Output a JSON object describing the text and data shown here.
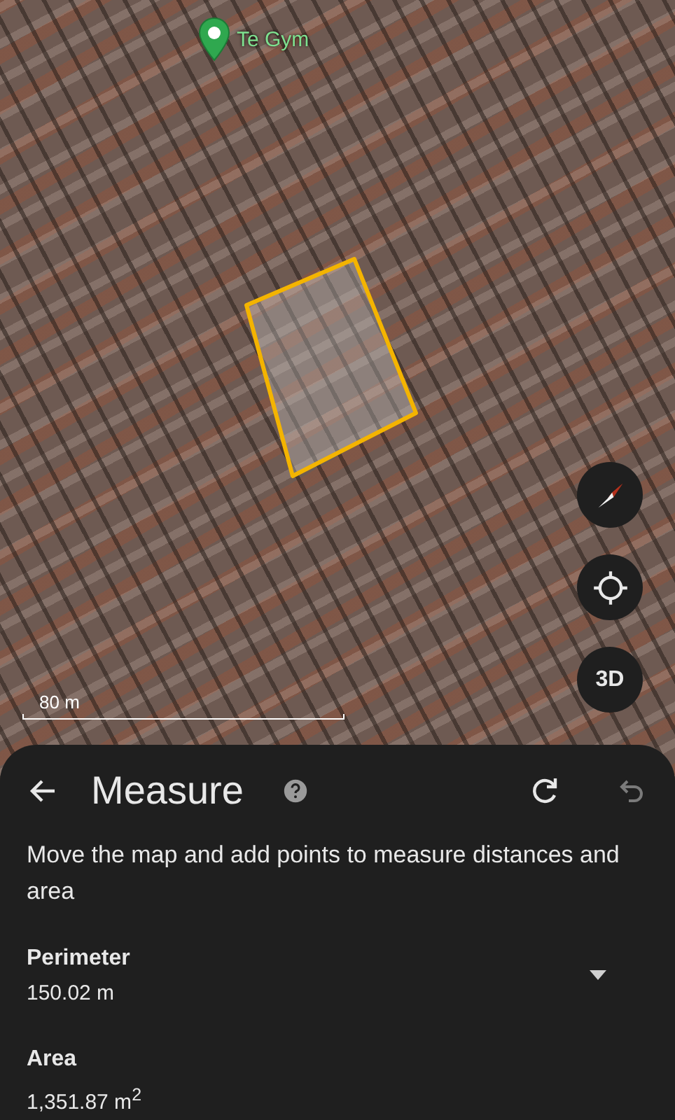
{
  "map": {
    "place_label": "Te Gym",
    "scale": "80 m"
  },
  "map_controls": [
    {
      "kind": "compass"
    },
    {
      "kind": "locate"
    },
    {
      "kind": "tilt",
      "label": "3D"
    }
  ],
  "panel": {
    "title": "Measure",
    "actions": [
      {
        "kind": "clear",
        "disabled": false
      },
      {
        "kind": "undo",
        "disabled": true
      }
    ],
    "instructions": "Move the map and add points to measure distances and area",
    "measurements": [
      {
        "label": "Perimeter",
        "value": "150.02 m",
        "expandable": true
      },
      {
        "label": "Area",
        "value": "1,351.87 m$^{2}$",
        "expandable": false
      }
    ]
  }
}
